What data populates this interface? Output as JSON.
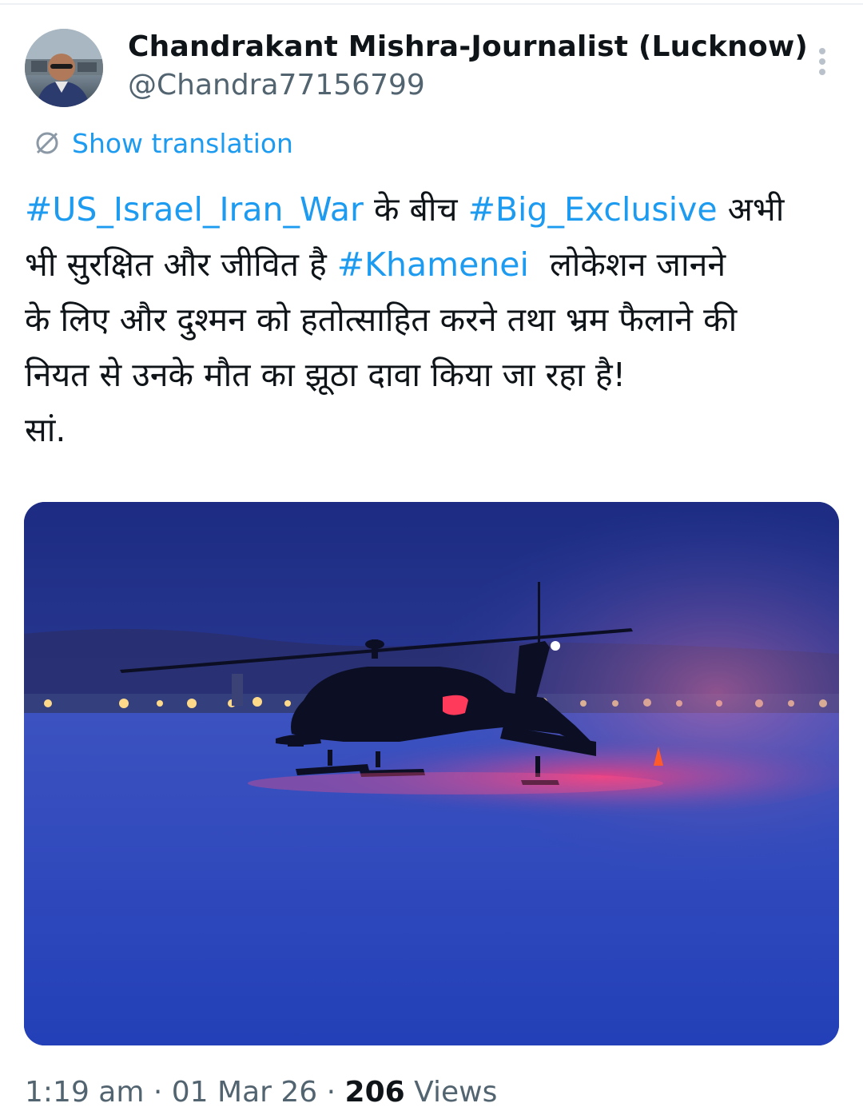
{
  "tweet": {
    "display_name": "Chandrakant Mishra-Journalist (Lucknow)",
    "handle": "@Chandra77156799",
    "show_translation_label": "Show translation",
    "text_lines": [
      [
        {
          "text": "#US_Israel_Iran_War",
          "type": "hashtag"
        },
        {
          "text": " के बीच ",
          "type": "text"
        },
        {
          "text": "#Big_Exclusive",
          "type": "hashtag"
        },
        {
          "text": " अभी",
          "type": "text"
        }
      ],
      [
        {
          "text": "भी सुरक्षित और जीवित है ",
          "type": "text"
        },
        {
          "text": "#Khamenei",
          "type": "hashtag"
        },
        {
          "text": "  लोकेशन जानने",
          "type": "text"
        }
      ],
      [
        {
          "text": "के लिए और दुश्मन को हतोत्साहित करने तथा भ्रम फैलाने की",
          "type": "text"
        }
      ],
      [
        {
          "text": "नियत से उनके मौत का झूठा दावा किया जा रहा है!",
          "type": "text"
        }
      ],
      [
        {
          "text": "सां.",
          "type": "text"
        }
      ]
    ],
    "time": "1:19 am",
    "separator": " · ",
    "date": "01 Mar 26",
    "views_count": "206",
    "views_label": " Views"
  },
  "icons": {
    "more": "more-vertical-icon",
    "translate": "translate-icon"
  },
  "colors": {
    "link": "#1d9bf0",
    "text_primary": "#0f1419",
    "text_secondary": "#536471"
  }
}
